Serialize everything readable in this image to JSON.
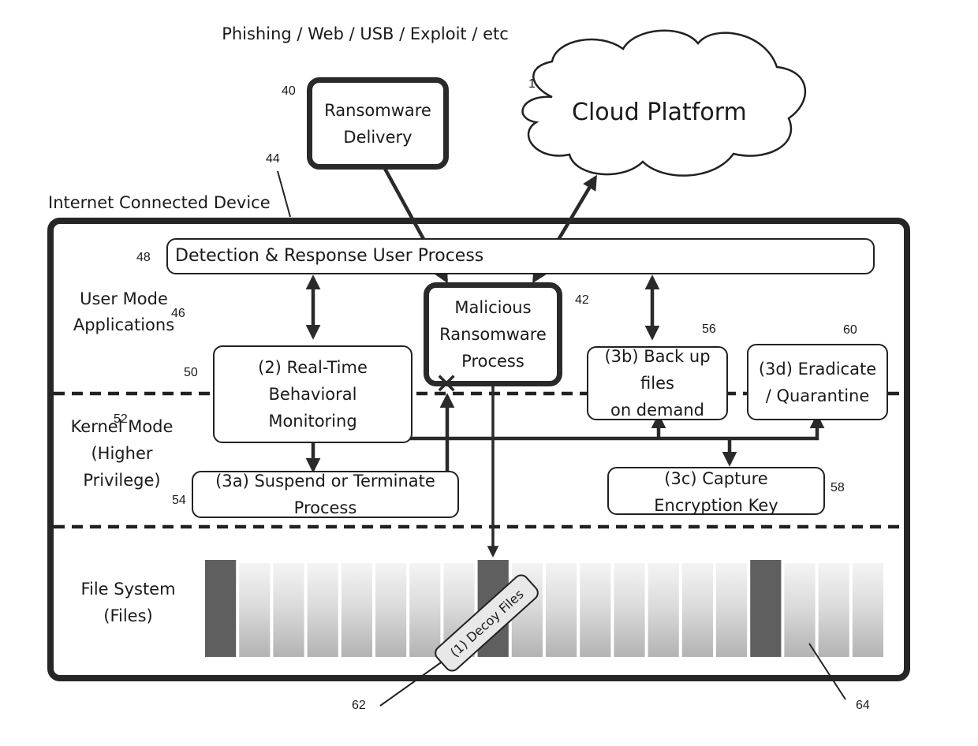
{
  "source_label": "Phishing / Web / USB / Exploit / etc",
  "nodes": {
    "delivery": {
      "ref": "40",
      "lines": [
        "Ransomware",
        "Delivery"
      ]
    },
    "cloud": {
      "ref": "1",
      "label": "Cloud Platform"
    },
    "device": {
      "ref": "44",
      "label": "Internet Connected Device"
    },
    "detection": {
      "ref": "48",
      "label": "Detection & Response User Process"
    },
    "malicious": {
      "ref": "42",
      "lines": [
        "Malicious",
        "Ransomware",
        "Process"
      ]
    },
    "monitoring": {
      "ref": "50",
      "lines": [
        "(2) Real-Time",
        "Behavioral",
        "Monitoring"
      ]
    },
    "suspend": {
      "ref": "54",
      "lines": [
        "(3a) Suspend or Terminate",
        "Process"
      ]
    },
    "backup": {
      "ref": "56",
      "lines": [
        "(3b) Back up",
        "files",
        "on demand"
      ]
    },
    "capture": {
      "ref": "58",
      "lines": [
        "(3c) Capture",
        "Encryption Key"
      ]
    },
    "eradicate": {
      "ref": "60",
      "lines": [
        "(3d) Eradicate",
        "/ Quarantine"
      ]
    },
    "decoy": {
      "ref": "62",
      "label": "(1) Decoy Files"
    },
    "files": {
      "ref": "64"
    }
  },
  "zones": {
    "user_mode": {
      "ref": "46",
      "lines": [
        "User Mode",
        "Applications"
      ]
    },
    "kernel_mode": {
      "ref": "52",
      "lines": [
        "Kernel Mode",
        "(Higher",
        "Privilege)"
      ]
    },
    "file_system": {
      "lines": [
        "File System",
        "(Files)"
      ]
    }
  },
  "file_columns": [
    "decoy",
    "file",
    "file",
    "file",
    "file",
    "file",
    "file",
    "file",
    "decoy",
    "file",
    "file",
    "file",
    "file",
    "file",
    "file",
    "file",
    "decoy",
    "file",
    "file",
    "file"
  ],
  "colors": {
    "ink": "#222222",
    "decoy": "#5f5f5f",
    "file_top": "#f2f2f2",
    "file_bottom": "#b5b5b5"
  }
}
